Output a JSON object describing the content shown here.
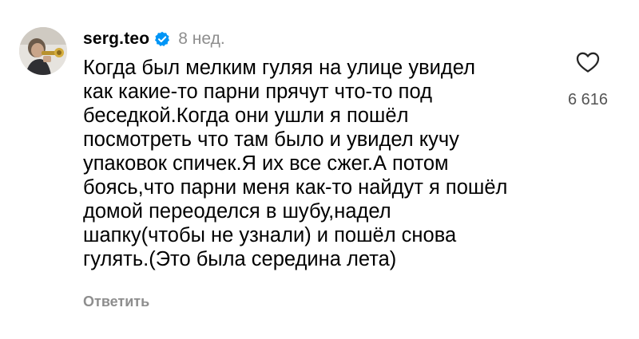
{
  "comment": {
    "username": "serg.teo",
    "verified": true,
    "time": "8 нед.",
    "text": "Когда был мелким гуляя на улице увидел\nкак какие-то парни прячут что-то под\nбеседкой.Когда они ушли я пошёл\nпосмотреть что там было и увидел кучу\nупаковок спичек.Я их все сжег.А потом\nбоясь,что парни меня как-то найдут я пошёл\nдомой переоделся в шубу,надел\nшапку(чтобы не узнали) и пошёл снова\nгулять.(Это была середина лета)",
    "reply_label": "Ответить",
    "like_count": "6 616"
  },
  "icons": {
    "verified": "verified-badge-icon",
    "like": "heart-outline-icon",
    "avatar": "user-avatar"
  },
  "colors": {
    "verified_blue": "#0095f6",
    "secondary_text": "#8e8e8e"
  }
}
